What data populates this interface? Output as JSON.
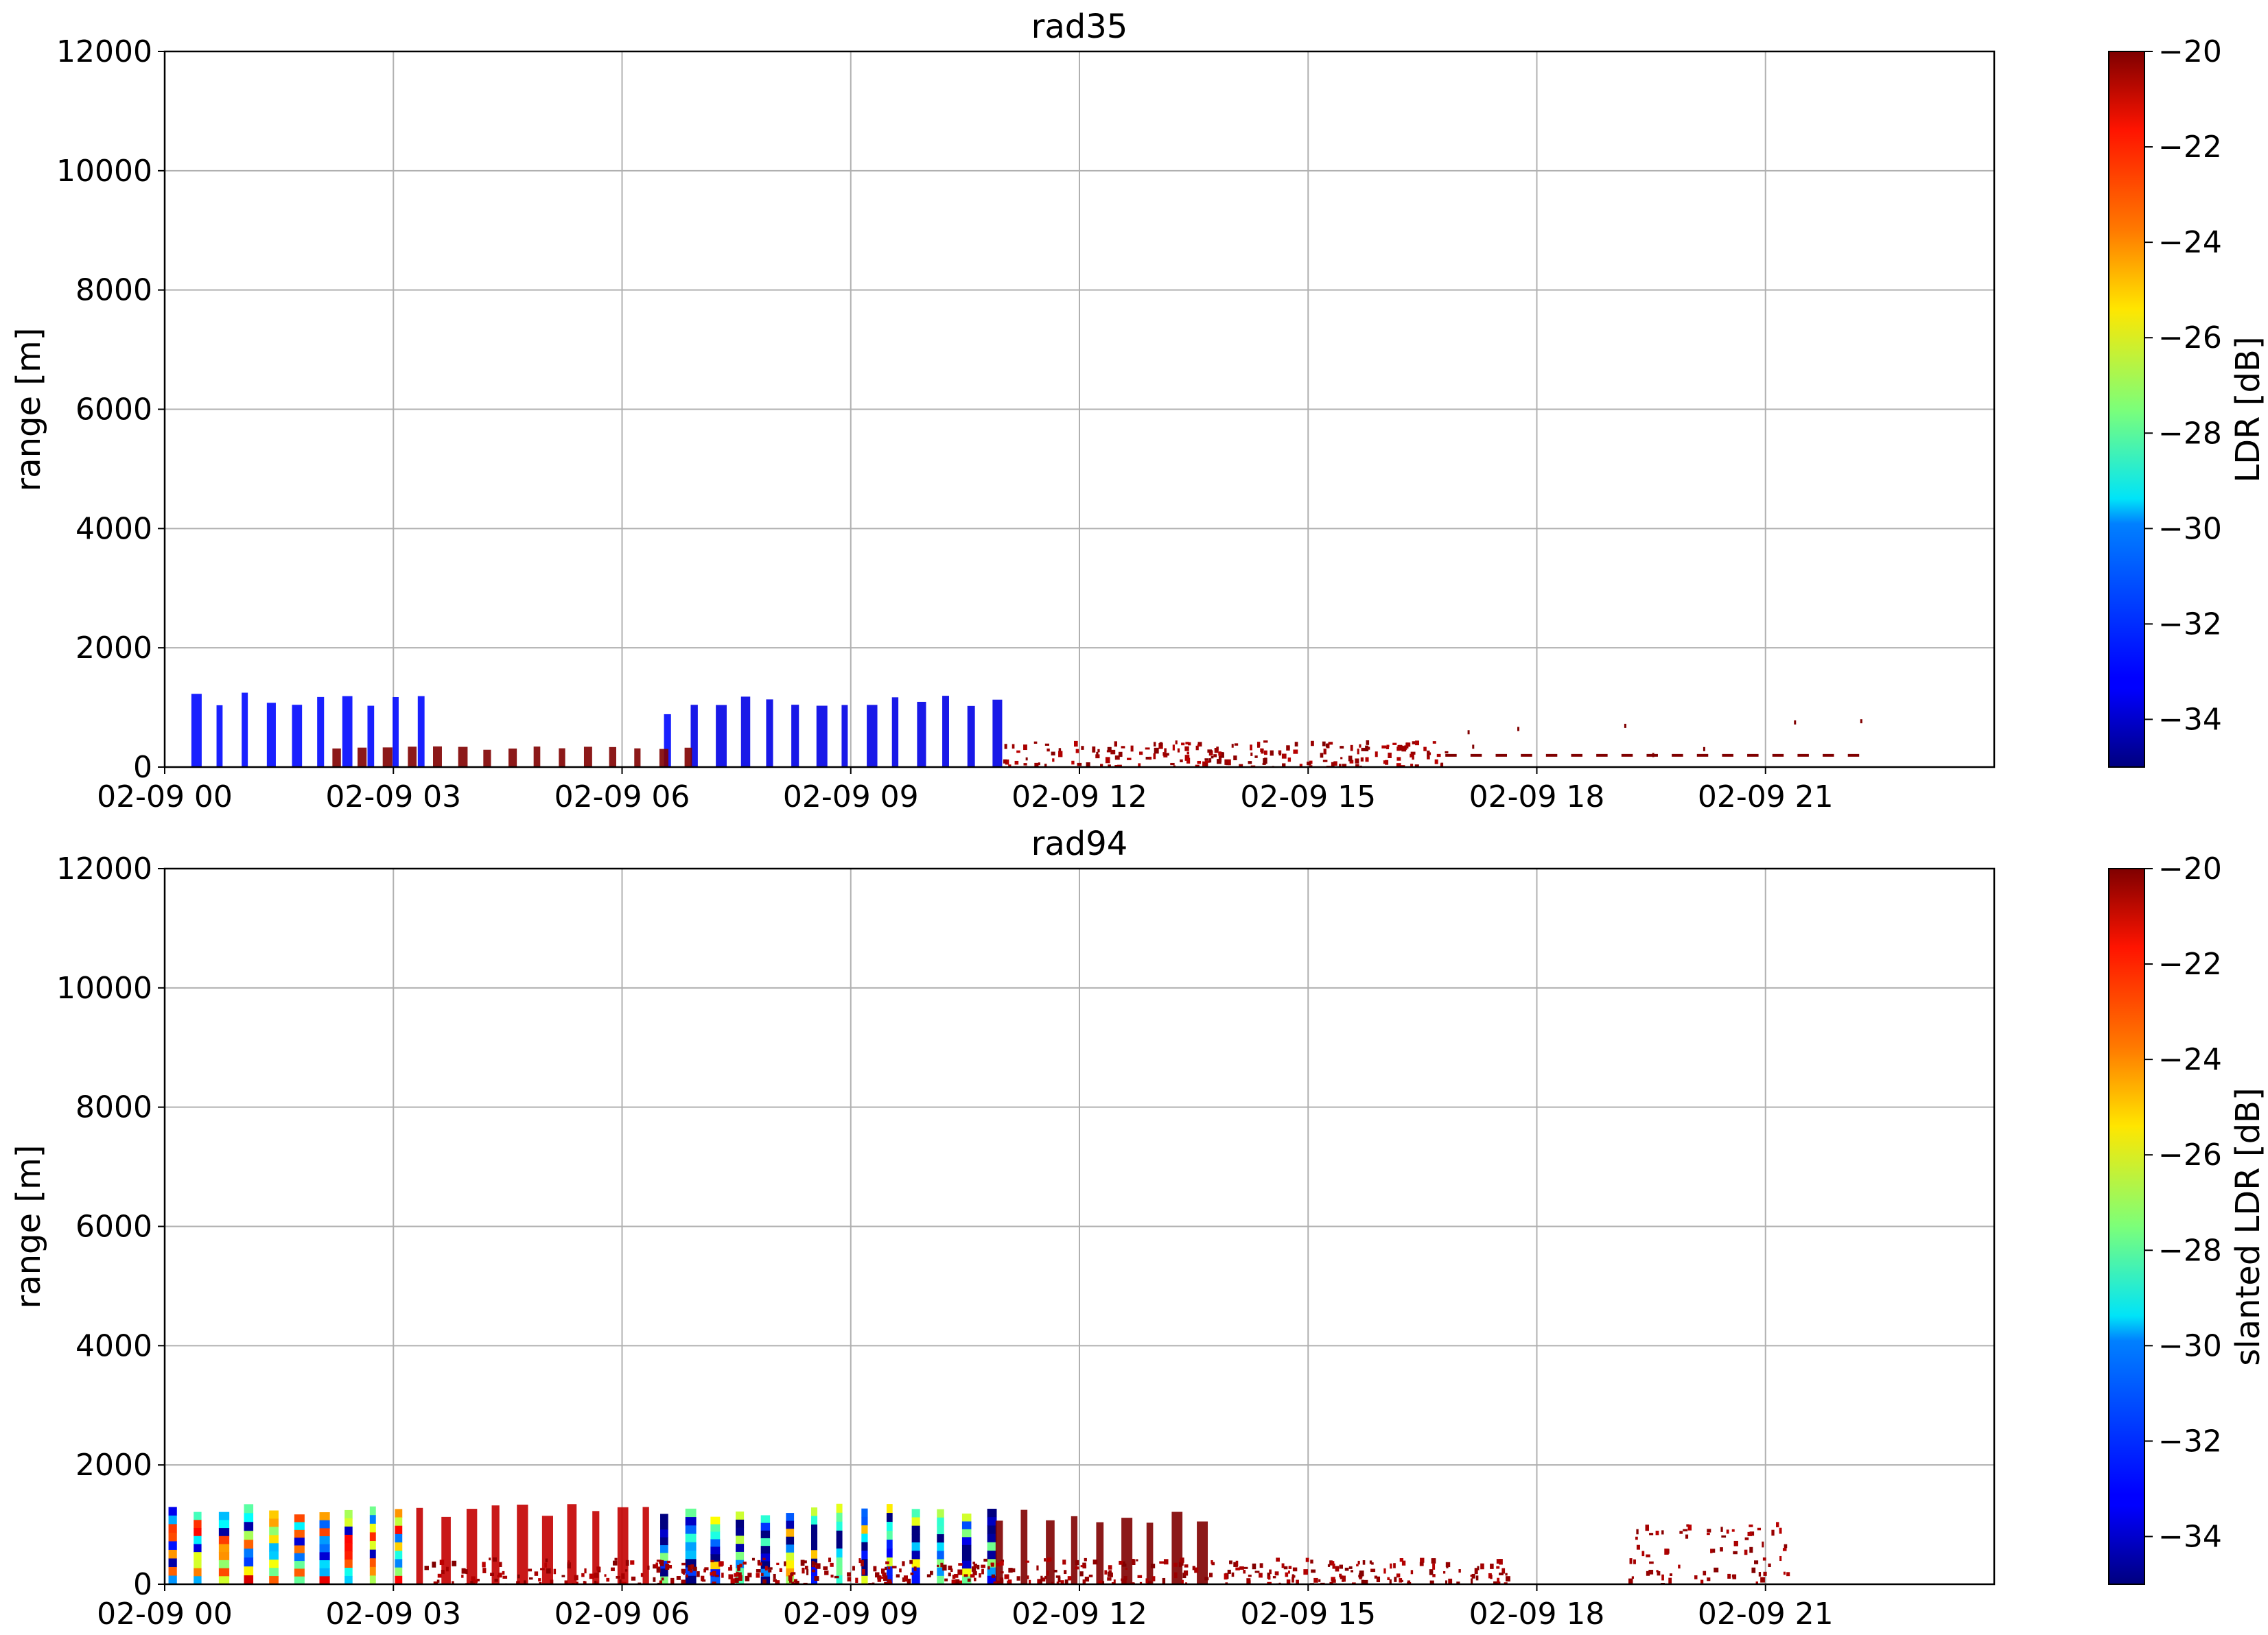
{
  "chart_data": [
    {
      "type": "heatmap",
      "title": "rad35",
      "xlabel": "",
      "ylabel": "range [m]",
      "xlim": [
        "02-09 00",
        "02-10 00"
      ],
      "ylim": [
        0,
        12000
      ],
      "x_ticks": [
        "02-09 00",
        "02-09 03",
        "02-09 06",
        "02-09 09",
        "02-09 12",
        "02-09 15",
        "02-09 18",
        "02-09 21"
      ],
      "y_ticks": [
        "0",
        "2000",
        "4000",
        "6000",
        "8000",
        "10000",
        "12000"
      ],
      "grid": true,
      "colorbar": {
        "label": "LDR [dB]",
        "colormap": "jet",
        "range": [
          -35,
          -20
        ],
        "ticks": [
          "−34",
          "−32",
          "−30",
          "−28",
          "−26",
          "−24",
          "−22",
          "−20"
        ]
      },
      "features": [
        {
          "start_hour": 0.35,
          "end_hour": 3.5,
          "top_m": 1250,
          "ldr_db": -33,
          "pattern": "columns"
        },
        {
          "start_hour": 6.55,
          "end_hour": 6.65,
          "top_m": 1050,
          "ldr_db": -33,
          "pattern": "columns"
        },
        {
          "start_hour": 6.9,
          "end_hour": 11.0,
          "top_m": 1250,
          "ldr_db": -33.5,
          "pattern": "columns"
        },
        {
          "start_hour": 2.2,
          "end_hour": 6.9,
          "top_m": 350,
          "ldr_db": -20,
          "pattern": "columns"
        },
        {
          "start_hour": 11.0,
          "end_hour": 16.8,
          "top_m": 450,
          "ldr_db": -20,
          "pattern": "speckle"
        },
        {
          "start_hour": 16.8,
          "end_hour": 22.3,
          "top_m": 220,
          "ldr_db": -20,
          "pattern": "dashes"
        }
      ]
    },
    {
      "type": "heatmap",
      "title": "rad94",
      "xlabel": "",
      "ylabel": "range [m]",
      "xlim": [
        "02-09 00",
        "02-10 00"
      ],
      "ylim": [
        0,
        12000
      ],
      "x_ticks": [
        "02-09 00",
        "02-09 03",
        "02-09 06",
        "02-09 09",
        "02-09 12",
        "02-09 15",
        "02-09 18",
        "02-09 21"
      ],
      "y_ticks": [
        "0",
        "2000",
        "4000",
        "6000",
        "8000",
        "10000",
        "12000"
      ],
      "grid": true,
      "colorbar": {
        "label": "slanted LDR [dB]",
        "colormap": "jet",
        "range": [
          -35,
          -20
        ],
        "ticks": [
          "−34",
          "−32",
          "−30",
          "−28",
          "−26",
          "−24",
          "−22",
          "−20"
        ]
      },
      "features": [
        {
          "start_hour": 0.05,
          "end_hour": 3.2,
          "top_m": 1380,
          "ldr_db": -28,
          "pattern": "multicolor"
        },
        {
          "start_hour": 3.3,
          "end_hour": 6.5,
          "top_m": 1350,
          "ldr_db": -21,
          "pattern": "columns"
        },
        {
          "start_hour": 6.5,
          "end_hour": 10.9,
          "top_m": 1350,
          "ldr_db": -31,
          "pattern": "multicolor"
        },
        {
          "start_hour": 10.9,
          "end_hour": 13.8,
          "top_m": 1250,
          "ldr_db": -20,
          "pattern": "columns"
        },
        {
          "start_hour": 3.3,
          "end_hour": 17.6,
          "top_m": 450,
          "ldr_db": -20,
          "pattern": "speckle"
        },
        {
          "start_hour": 19.2,
          "end_hour": 21.3,
          "top_m": 1050,
          "ldr_db": -20,
          "pattern": "speckle"
        }
      ]
    }
  ]
}
